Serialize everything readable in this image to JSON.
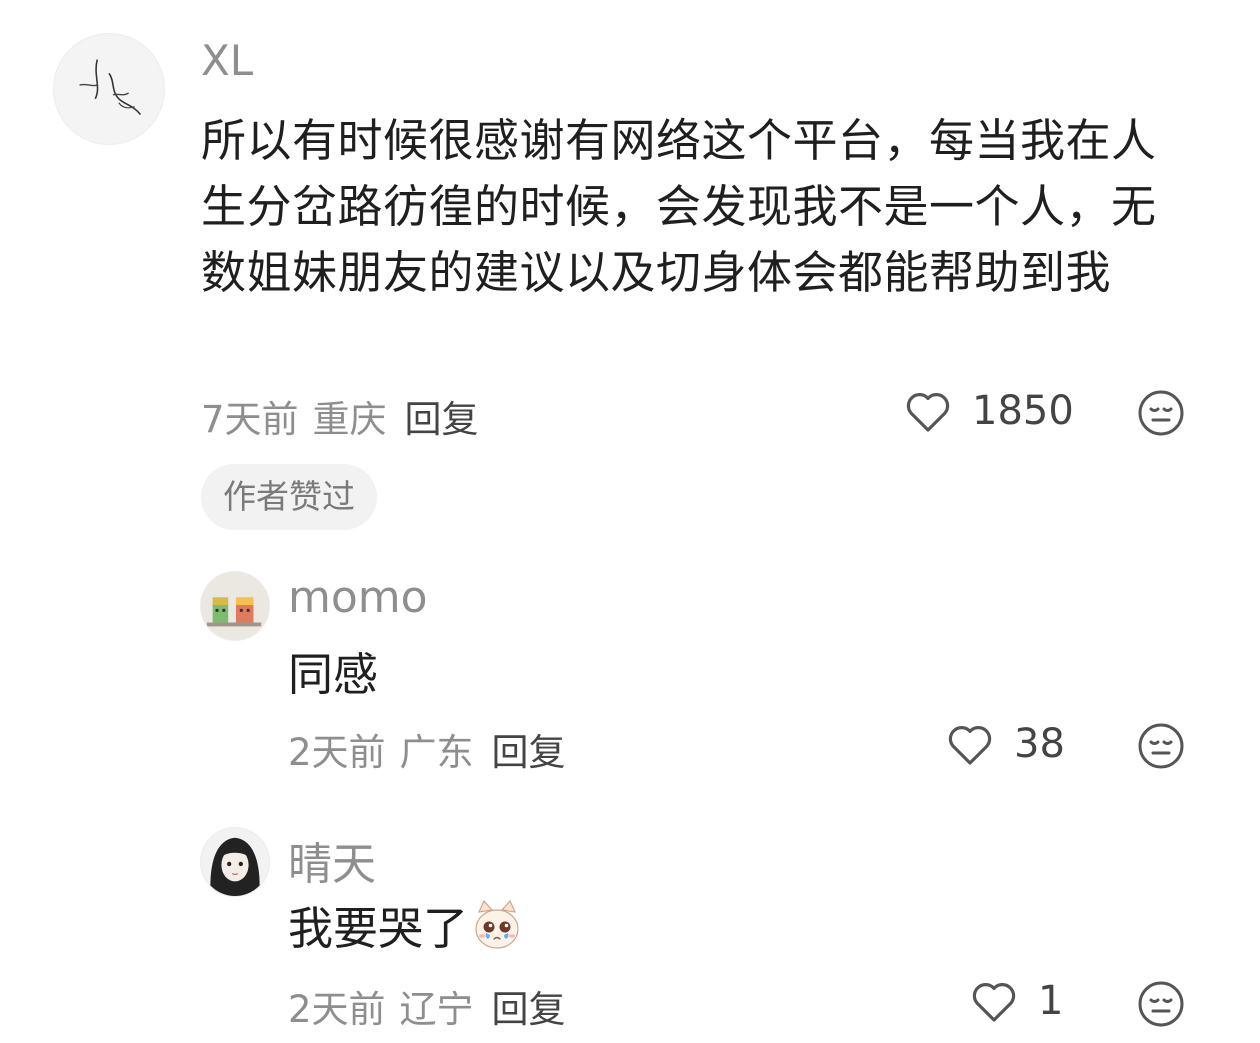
{
  "comments": [
    {
      "username": "XL",
      "text": "所以有时候很感谢有网络这个平台，每当我在人生分岔路彷徨的时候，会发现我不是一个人，无数姐妹朋友的建议以及切身体会都能帮助到我",
      "time": "7天前",
      "location": "重庆",
      "reply_label": "回复",
      "likes": "1850",
      "badge": "作者赞过"
    },
    {
      "username": "momo",
      "text": "同感",
      "time": "2天前",
      "location": "广东",
      "reply_label": "回复",
      "likes": "38"
    },
    {
      "username": "晴天",
      "text": "我要哭了",
      "emoji": "crying-cat-emoji",
      "time": "2天前",
      "location": "辽宁",
      "reply_label": "回复",
      "likes": "1"
    }
  ],
  "icons": {
    "like": "heart-outline-icon",
    "dislike": "neutral-face-icon"
  },
  "colors": {
    "text": "#1f1f1f",
    "meta": "#8e8e8e",
    "reply": "#444444",
    "badge_bg": "#f2f2f2"
  }
}
